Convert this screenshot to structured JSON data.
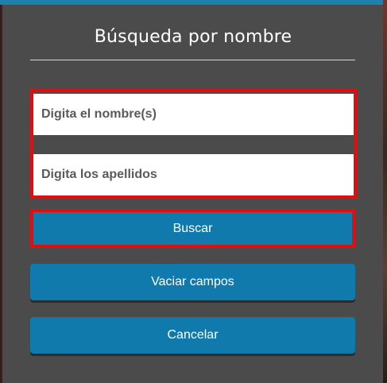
{
  "dialog": {
    "title": "Búsqueda por nombre"
  },
  "form": {
    "first_name_placeholder": "Digita el nombre(s)",
    "last_name_placeholder": "Digita los apellidos"
  },
  "buttons": {
    "search_label": "Buscar",
    "clear_label": "Vaciar campos",
    "cancel_label": "Cancelar"
  },
  "colors": {
    "button": "#0f7aab",
    "highlight": "#e40d0d",
    "dialog_bg": "#4b4b4b",
    "accent_bar": "#1d80ad"
  }
}
